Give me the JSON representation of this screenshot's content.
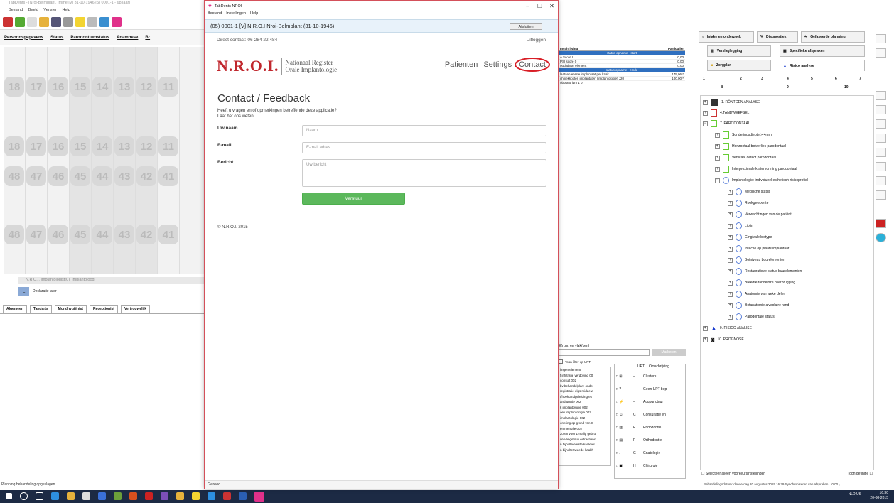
{
  "background": {
    "title": "TabDents - [Nroi-Belmplant, Imme [V] 31-10-1946 (5) 0001-1 - 68 jaar]",
    "menu": [
      "Bestand",
      "Beeld",
      "Venster",
      "Help"
    ],
    "tabs": [
      "Persoonsgegevens",
      "Status",
      "Parodontiumstatus",
      "Anamnese",
      "Br"
    ],
    "tooth_numbers_upper": [
      "18",
      "17",
      "16",
      "15",
      "14",
      "13",
      "12",
      "11"
    ],
    "tooth_numbers_lower": [
      "48",
      "47",
      "46",
      "45",
      "44",
      "43",
      "42",
      "41"
    ],
    "provider_label": "N.R.O.I. Implantologist(0), Implantoloog",
    "declaratie_label": "Declaratie later",
    "declaratie_code": "L",
    "bottom_tabs": [
      "Algemeen",
      "Tandarts",
      "Mondhygiënist",
      "Receptionist",
      "Vertrouwelijk"
    ],
    "status_left": "Planning behandeling opgeslagen",
    "mid_table": {
      "headers": [
        "mschrijving",
        "Particulier",
        "Verzek"
      ],
      "band1": "status opname - start",
      "rows1": [
        [
          "A Score I",
          "0,00"
        ],
        [
          "PSI score 0",
          "0,00"
        ],
        [
          "ouchtbaar element",
          "0,00"
        ]
      ],
      "band2": "status opname - einde",
      "rows2": [
        [
          "laatsen eerste implantaat per kaak",
          "175,06 *"
        ],
        [
          "chniekkosten implantaten (implantologie) J20",
          "100,00 *"
        ],
        [
          "oboratorium 1 0",
          ""
        ]
      ]
    },
    "mid_search_label": "E(n.nr. en vlak(ken)",
    "mid_search_button": "Markeren",
    "filter_label": "Toon filter op UPT",
    "mid_list": [
      "lingen element",
      "f infiltratie verdoving 00",
      "consult 002",
      "bv behandelplan: onder",
      "registratie elgs middelw",
      "t/hoektandgeleiding ex",
      "andfunctie 002",
      "k implantologie 002",
      "oek implantologie 002",
      "implantologie 002",
      "onering op grond van C",
      "en mentale 002",
      "zoren voor 1-malig gebru",
      "vervangers in extractiewo",
      "n bijholte eerste kaakhel",
      "n bijholte tweede kaakh"
    ],
    "upt_headers": [
      "UPT",
      "Omschrijving"
    ],
    "upt_rows": [
      {
        "code": "–",
        "label": "Clusters"
      },
      {
        "code": "–",
        "label": "Geen UPT bep"
      },
      {
        "code": "–",
        "label": "Acupunctuur"
      },
      {
        "code": "C",
        "label": "Consultatie en"
      },
      {
        "code": "E",
        "label": "Endodontie"
      },
      {
        "code": "F",
        "label": "Orthodontie"
      },
      {
        "code": "G",
        "label": "Gnatologie"
      },
      {
        "code": "H",
        "label": "Chirurgie"
      }
    ],
    "right_tabs": [
      "Intake en onderzoek",
      "Diagnostiek",
      "Gefaseerde planning",
      "Verslaglegging",
      "Specifieke afspraken",
      "Zorgplan",
      "Risico analyse"
    ],
    "counters": [
      "1",
      "2",
      "3",
      "4",
      "5",
      "6",
      "7",
      "8",
      "9",
      "10"
    ],
    "tree": [
      "1. RÖNTGEN ANALYSE",
      "4.TANDWEEFSEL",
      "7. PARODONTAAL",
      "Sonderingsdiepte > 4mm.",
      "Horizontaal botverlies parodontaal",
      "Verticaal defect parodontaal",
      "Interproximale kratervorming parodontaal",
      "Implantologie: individueel esthetisch risicoprofiel",
      "Medische status",
      "Rookgewoonte",
      "Verwachtingen van de patiënt",
      "Lipljn",
      "Gingivale biotype",
      "Infectie op plaats implantaat",
      "Botniveau buurelementen",
      "Restauratieve status buurelementen",
      "Breedte tandeloze overbrugging",
      "Anatomie van weke delen",
      "Botanatomie alveolaire rand",
      "Parodontale status",
      "9. RISICO ANALISE",
      "10. PROGNOSE"
    ],
    "bottom_right_left": "Selecteer alléén voorkeursinstellingen",
    "bottom_right_right": "Toon definitie",
    "status_right": "Behandelingsdatum: donderdag 20 augustus 2015  16:29  Synchroniseren van afspraken...  0,00 ₓ",
    "clock_time": "16:30",
    "clock_date": "20-08-2015",
    "lang": "NLD US"
  },
  "modal": {
    "title": "TabDents NROI",
    "menu": [
      "Bestand",
      "Instellingen",
      "Help"
    ],
    "header_text": "(05) 0001-1 [V] N.R.O.I Nroi-Belmplant  (31-10-1946)",
    "close_button": "Afsluiten",
    "direct_contact": "Direct contact: 06-284 22.484",
    "logout": "Uitloggen",
    "logo_mark": "N.R.O.I.",
    "logo_line1": "Nationaal Register",
    "logo_line2": "Orale Implantologie",
    "nav": [
      "Patienten",
      "Settings",
      "Contact"
    ],
    "heading": "Contact / Feedback",
    "sub1": "Heeft u vragen en of opmerkingen betreffende deze applicatie?",
    "sub2": "Laat het ons weten!",
    "name_label": "Uw naam",
    "name_placeholder": "Naam",
    "email_label": "E-mail",
    "email_placeholder": "E-mail adres",
    "message_label": "Bericht",
    "message_placeholder": "Uw bericht",
    "submit": "Verstuur",
    "copyright": "© N.R.O.I. 2015",
    "status": "Gereed"
  },
  "colors": {
    "accent_red": "#c0272d",
    "submit_green": "#5cb85c",
    "highlight_oval": "#d81e26",
    "taskbar": "#1c2a44",
    "header_blue": "#e8f2fa"
  }
}
